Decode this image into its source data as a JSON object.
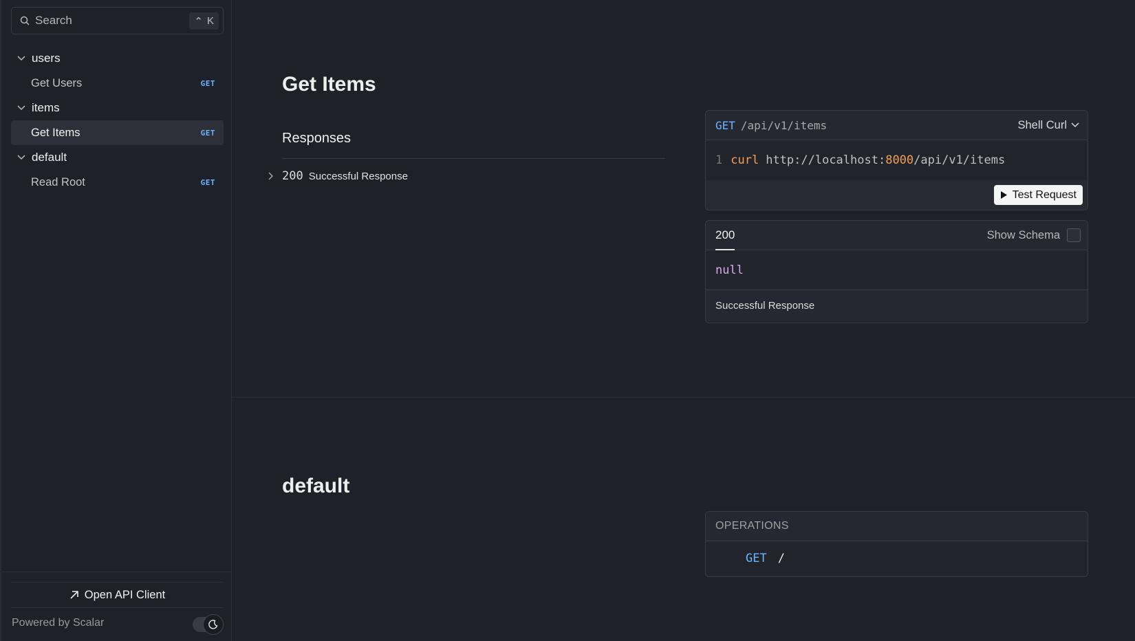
{
  "search": {
    "placeholder": "Search",
    "shortcut_mod": "⌃",
    "shortcut_key": "K"
  },
  "sidebar": {
    "groups": [
      {
        "label": "users",
        "items": [
          {
            "label": "Get Users",
            "method": "GET"
          }
        ]
      },
      {
        "label": "items",
        "items": [
          {
            "label": "Get Items",
            "method": "GET",
            "active": true
          }
        ]
      },
      {
        "label": "default",
        "items": [
          {
            "label": "Read Root",
            "method": "GET"
          }
        ]
      }
    ],
    "open_client_label": "Open API Client",
    "powered_by": "Powered by Scalar"
  },
  "endpoint": {
    "title": "Get Items",
    "responses_title": "Responses",
    "response_code": "200",
    "response_desc": "Successful Response",
    "request": {
      "method": "GET",
      "path": "/api/v1/items",
      "client": "Shell Curl",
      "line_number": "1",
      "command": "curl",
      "url_prefix": "http://localhost:",
      "port": "8000",
      "url_suffix": "/api/v1/items",
      "test_button": "Test Request"
    },
    "response_card": {
      "tab": "200",
      "show_schema": "Show Schema",
      "body": "null",
      "description": "Successful Response"
    }
  },
  "default_section": {
    "title": "default",
    "operations_label": "OPERATIONS",
    "operation": {
      "method": "GET",
      "path": "/"
    }
  },
  "colors": {
    "accent_get": "#6cb4ff",
    "port": "#f2a057",
    "null": "#d8a6f2"
  }
}
